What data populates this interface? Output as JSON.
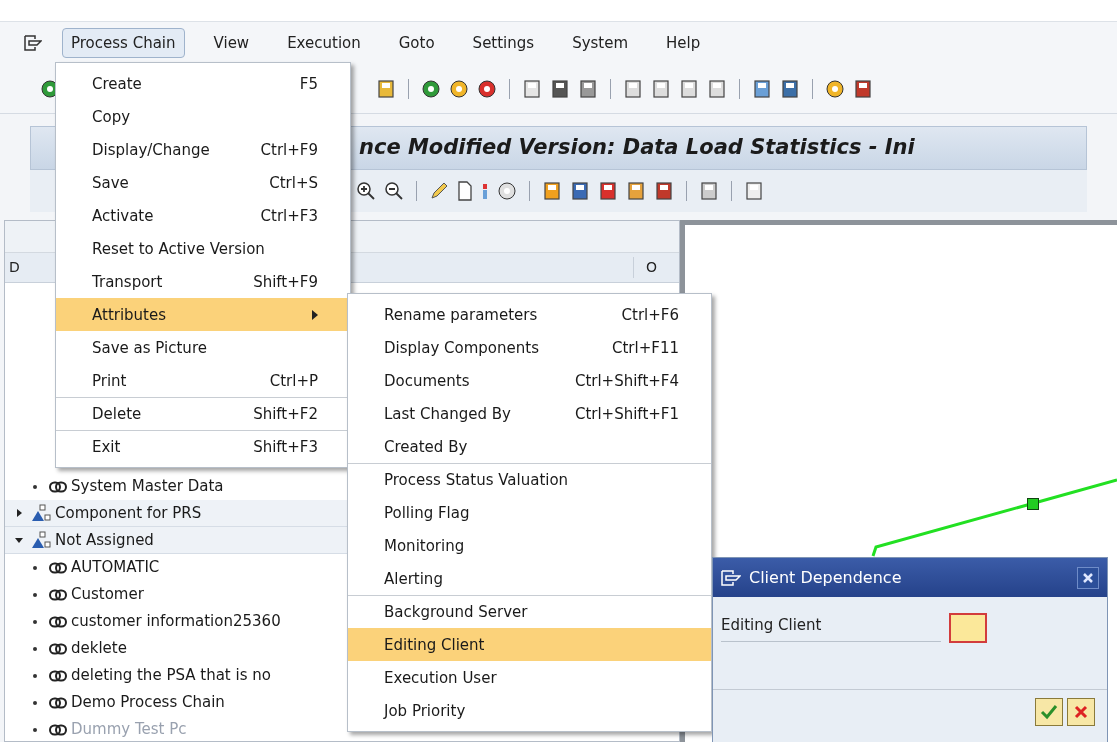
{
  "menu_bar": [
    {
      "label": "Process Chain",
      "selected": true
    },
    {
      "label": "View",
      "selected": false
    },
    {
      "label": "Execution",
      "selected": false
    },
    {
      "label": "Goto",
      "selected": false
    },
    {
      "label": "Settings",
      "selected": false
    },
    {
      "label": "System",
      "selected": false
    },
    {
      "label": "Help",
      "selected": false
    }
  ],
  "title": "nce Modified Version: Data Load Statistics - Ini",
  "tree": {
    "columns": [
      "D",
      "O"
    ],
    "items": [
      {
        "label": "System Master Data",
        "kind": "chain",
        "inactive": false
      },
      {
        "label": "Component for PRS",
        "kind": "group",
        "expanded": false
      },
      {
        "label": "Not Assigned",
        "kind": "group",
        "expanded": true,
        "children": [
          {
            "label": "AUTOMATIC",
            "kind": "chain",
            "inactive": false
          },
          {
            "label": "Customer",
            "kind": "chain",
            "inactive": false
          },
          {
            "label": "customer information25360",
            "kind": "chain",
            "inactive": false
          },
          {
            "label": "deklete",
            "kind": "chain",
            "inactive": false
          },
          {
            "label": "deleting the PSA that is no",
            "kind": "chain",
            "inactive": false
          },
          {
            "label": "Demo Process Chain",
            "kind": "chain",
            "inactive": false
          },
          {
            "label": "Dummy Test Pc",
            "kind": "chain",
            "inactive": true
          }
        ]
      }
    ]
  },
  "process_chain_menu": [
    {
      "label": "Create",
      "shortcut": "F5",
      "selected": false,
      "separator_before": false,
      "submenu": false
    },
    {
      "label": "Copy",
      "selected": false,
      "separator_before": false,
      "submenu": false
    },
    {
      "label": "Display/Change",
      "shortcut": "Ctrl+F9",
      "selected": false,
      "separator_before": false,
      "submenu": false
    },
    {
      "label": "Save",
      "shortcut": "Ctrl+S",
      "selected": false,
      "separator_before": false,
      "submenu": false
    },
    {
      "label": "Activate",
      "shortcut": "Ctrl+F3",
      "selected": false,
      "separator_before": false,
      "submenu": false
    },
    {
      "label": "Reset to Active Version",
      "selected": false,
      "separator_before": false,
      "submenu": false
    },
    {
      "label": "Transport",
      "shortcut": "Shift+F9",
      "selected": false,
      "separator_before": false,
      "submenu": false
    },
    {
      "label": "Attributes",
      "selected": true,
      "separator_before": false,
      "submenu": true
    },
    {
      "label": "Save as Picture",
      "selected": false,
      "separator_before": false,
      "submenu": false
    },
    {
      "label": "Print",
      "shortcut": "Ctrl+P",
      "selected": false,
      "separator_before": false,
      "submenu": false
    },
    {
      "label": "Delete",
      "shortcut": "Shift+F2",
      "selected": false,
      "separator_before": true,
      "submenu": false
    },
    {
      "label": "Exit",
      "shortcut": "Shift+F3",
      "selected": false,
      "separator_before": true,
      "submenu": false
    }
  ],
  "attributes_menu": [
    {
      "label": "Rename parameters",
      "shortcut": "Ctrl+F6",
      "selected": false,
      "separator_before": false
    },
    {
      "label": "Display Components",
      "shortcut": "Ctrl+F11",
      "selected": false,
      "separator_before": false
    },
    {
      "label": "Documents",
      "shortcut": "Ctrl+Shift+F4",
      "selected": false,
      "separator_before": false
    },
    {
      "label": "Last Changed By",
      "shortcut": "Ctrl+Shift+F1",
      "selected": false,
      "separator_before": false
    },
    {
      "label": "Created By",
      "selected": false,
      "separator_before": false
    },
    {
      "label": "Process Status Valuation",
      "selected": false,
      "separator_before": true
    },
    {
      "label": "Polling Flag",
      "selected": false,
      "separator_before": false
    },
    {
      "label": "Monitoring",
      "selected": false,
      "separator_before": false
    },
    {
      "label": "Alerting",
      "selected": false,
      "separator_before": false
    },
    {
      "label": "Background Server",
      "selected": false,
      "separator_before": true
    },
    {
      "label": "Editing Client",
      "selected": true,
      "separator_before": false
    },
    {
      "label": "Execution User",
      "selected": false,
      "separator_before": false
    },
    {
      "label": "Job Priority",
      "selected": false,
      "separator_before": false
    }
  ],
  "dialog": {
    "title": "Client Dependence",
    "field_label": "Editing Client"
  }
}
